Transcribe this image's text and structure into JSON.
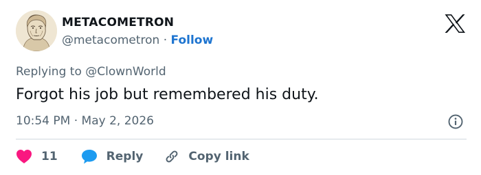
{
  "author": {
    "display_name": "METACOMETRON",
    "handle": "@metacometron",
    "separator": "·",
    "follow_label": "Follow"
  },
  "post": {
    "replying_prefix": "Replying to",
    "replying_to": "@ClownWorld",
    "text": "Forgot his job but remembered his duty.",
    "time": "10:54 PM",
    "time_separator": "·",
    "date": "May 2, 2026"
  },
  "actions": {
    "like_count": "11",
    "reply_label": "Reply",
    "copy_label": "Copy link"
  },
  "icons": {
    "brand": "x-logo-icon",
    "info": "info-icon",
    "like": "heart-icon",
    "reply": "speech-bubble-icon",
    "copy": "link-icon"
  },
  "colors": {
    "text": "#0f1419",
    "secondary": "#536471",
    "follow": "#1d74d0",
    "like": "#f91880",
    "reply": "#1d9bf0",
    "divider": "#cfd9de"
  }
}
